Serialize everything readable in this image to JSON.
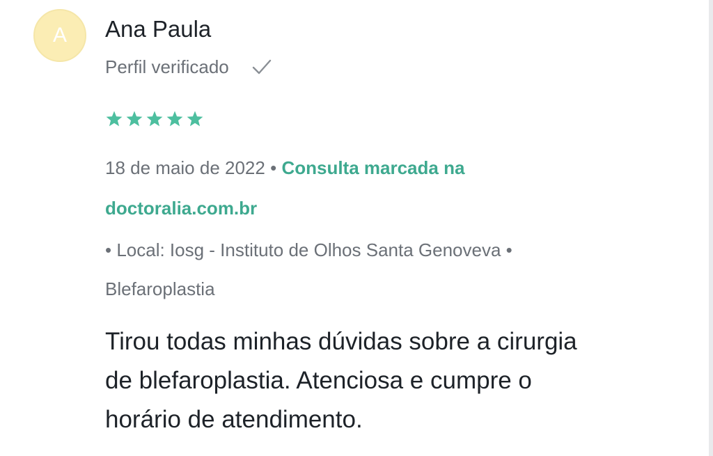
{
  "review": {
    "avatar_initial": "A",
    "author_name": "Ana Paula",
    "verified_label": "Perfil verificado",
    "rating": 5,
    "rating_max": 5,
    "star_color": "#4dbf9f",
    "date": "18 de maio de 2022",
    "separator": "•",
    "booking_text_1": "Consulta marcada na",
    "booking_text_2": "doctoralia.com.br",
    "location_text": "• Local: Iosg - Instituto de Olhos Santa Genoveva •",
    "service": "Blefaroplastia",
    "comment_line_1": "Tirou todas minhas dúvidas sobre a cirurgia",
    "comment_line_2": "de blefaroplastia. Atenciosa e cumpre o",
    "comment_line_3": "horário de atendimento."
  },
  "colors": {
    "accent_green": "#3ea98f",
    "avatar_bg": "#fbedb4",
    "muted_text": "#6b7077"
  },
  "icons": {
    "check": "check-icon",
    "star": "star-icon"
  }
}
